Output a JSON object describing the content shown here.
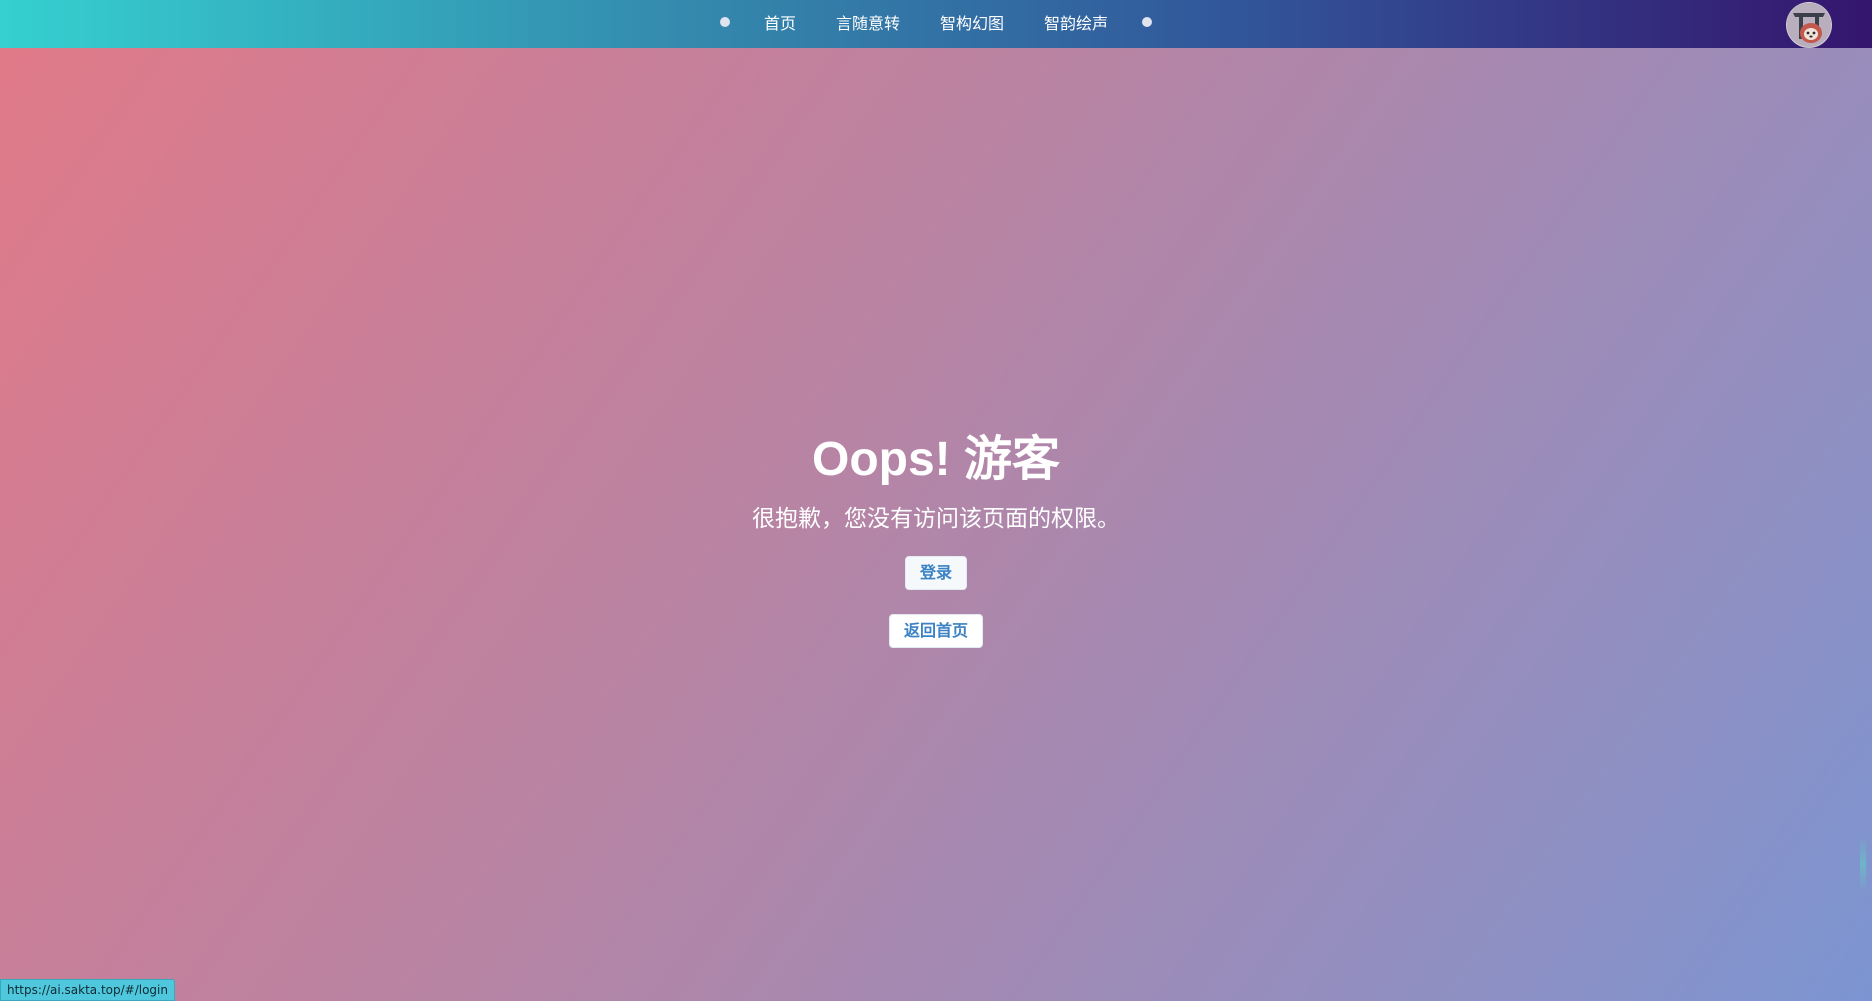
{
  "nav": {
    "items": [
      {
        "label": "首页"
      },
      {
        "label": "言随意转"
      },
      {
        "label": "智构幻图"
      },
      {
        "label": "智韵绘声"
      }
    ]
  },
  "user": {
    "avatar_icon": "avatar-icon"
  },
  "message": {
    "title": "Oops! 游客",
    "subtitle": "很抱歉，您没有访问该页面的权限。"
  },
  "actions": {
    "login_label": "登录",
    "home_label": "返回首页"
  },
  "status_bar": {
    "url": "https://ai.sakta.top/#/login"
  },
  "colors": {
    "topbar_start": "#35d0d0",
    "topbar_end": "#35156e",
    "background_start": "#e27a88",
    "background_end": "#7c95d2",
    "button_text": "#3b82c4"
  }
}
